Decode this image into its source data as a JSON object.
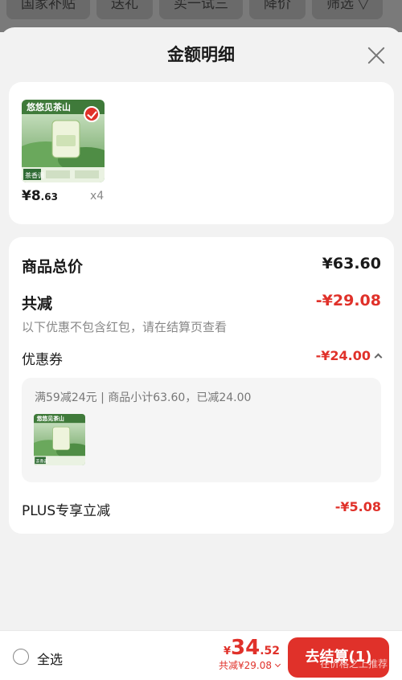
{
  "filter_bar": {
    "chips": [
      "国家补贴",
      "送礼",
      "买一试三",
      "降价",
      "筛选 ▽"
    ]
  },
  "sheet": {
    "title": "金额明细"
  },
  "product": {
    "image_label": "悠悠见茶山",
    "price_main": "¥8",
    "price_dec": ".63",
    "qty": "x4"
  },
  "detail": {
    "total_label": "商品总价",
    "total_value": "¥63.60",
    "discount_label": "共减",
    "discount_value": "-¥29.08",
    "discount_note": "以下优惠不包含红包，请在结算页查看",
    "coupon_label": "优惠券",
    "coupon_value": "-¥24.00",
    "coupon_desc": "满59减24元 | 商品小计63.60，已减24.00",
    "plus_label": "PLUS专享立减",
    "plus_value": "-¥5.08"
  },
  "bottom": {
    "select_all": "全选",
    "yen": "¥",
    "total_int": "34",
    "total_dec": ".52",
    "total_sub": "共减¥29.08",
    "checkout": "去结算(1)",
    "watermark": "在价格之上推荐"
  },
  "colors": {
    "accent": "#e0312a",
    "tea_green": "#8fc36b"
  }
}
